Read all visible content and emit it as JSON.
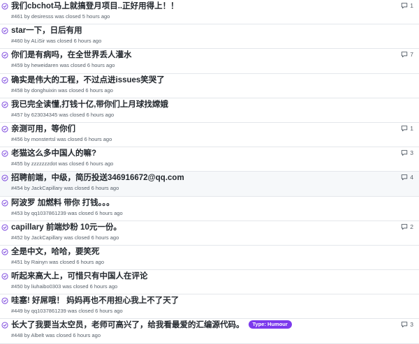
{
  "colors": {
    "closed_icon": "#8250df",
    "label_humour": "#7c3aed",
    "row_highlight": "#f6f8fa"
  },
  "icons": {
    "state": "issue-closed-icon",
    "comment": "comment-icon"
  },
  "issues": [
    {
      "title": "我们cbchot马上就搞登月项目..正好用得上！！",
      "meta": "#461 by desiresss was closed 5 hours ago",
      "comments": "1",
      "highlight": false,
      "label": ""
    },
    {
      "title": "star一下，日后有用",
      "meta": "#460 by ALiSir was closed 6 hours ago",
      "comments": "",
      "highlight": false,
      "label": ""
    },
    {
      "title": "你们是有病吗，在全世界丢人灌水",
      "meta": "#459 by heweidaren was closed 6 hours ago",
      "comments": "7",
      "highlight": false,
      "label": ""
    },
    {
      "title": "确实是伟大的工程，不过点进issues笑哭了",
      "meta": "#458 by donghuixin was closed 6 hours ago",
      "comments": "",
      "highlight": false,
      "label": ""
    },
    {
      "title": "我已完全读懂,打钱十亿,带你们上月球找嫦娥",
      "meta": "#457 by 623034345 was closed 6 hours ago",
      "comments": "",
      "highlight": false,
      "label": ""
    },
    {
      "title": "亲测可用，等你们",
      "meta": "#456 by monstertsl was closed 6 hours ago",
      "comments": "1",
      "highlight": false,
      "label": ""
    },
    {
      "title": "老猫这么多中国人的嘛?",
      "meta": "#455 by zzzzzzzdot was closed 6 hours ago",
      "comments": "3",
      "highlight": false,
      "label": ""
    },
    {
      "title": "招聘前端，中级，简历投送346916672@qq.com",
      "meta": "#454 by JackCapillary was closed 6 hours ago",
      "comments": "4",
      "highlight": true,
      "label": ""
    },
    {
      "title": "阿波罗 加燃料 带你 打钱。。。",
      "meta": "#453 by qq1037861239 was closed 6 hours ago",
      "comments": "",
      "highlight": false,
      "label": ""
    },
    {
      "title": "capillary 前端炒粉 10元一份。",
      "meta": "#452 by JackCapillary was closed 6 hours ago",
      "comments": "2",
      "highlight": false,
      "label": ""
    },
    {
      "title": "全是中文，哈哈，要笑死",
      "meta": "#451 by Rainyn was closed 6 hours ago",
      "comments": "",
      "highlight": false,
      "label": ""
    },
    {
      "title": "听起来高大上，可惜只有中国人在评论",
      "meta": "#450 by liuhaibo0303 was closed 6 hours ago",
      "comments": "",
      "highlight": false,
      "label": ""
    },
    {
      "title": "哇塞! 好屌哦！ 妈妈再也不用担心我上不了天了",
      "meta": "#449 by qq1037861239 was closed 6 hours ago",
      "comments": "",
      "highlight": false,
      "label": ""
    },
    {
      "title": "长大了我要当太空员，老师可高兴了，给我看最爱的汇编源代码。",
      "meta": "#448 by Albelt was closed 6 hours ago",
      "comments": "3",
      "highlight": false,
      "label": "Type: Humour"
    }
  ]
}
